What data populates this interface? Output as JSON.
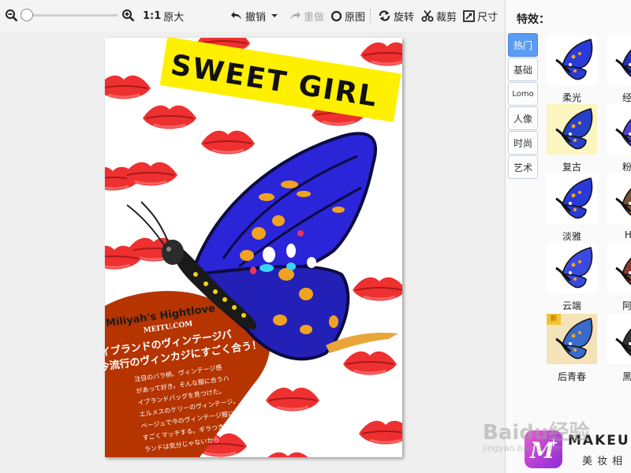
{
  "toolbar": {
    "zoom_out_icon": "zoom-out-icon",
    "zoom_in_icon": "zoom-in-icon",
    "zoom_value": 0,
    "actual_size_ratio": "1:1",
    "actual_size_label": "原大",
    "undo_label": "撤销",
    "redo_label": "重做",
    "original_label": "原图",
    "rotate_label": "旋转",
    "crop_label": "裁剪",
    "resize_label": "尺寸"
  },
  "poster": {
    "banner": "SWEET GIRL",
    "heart_title": "Miliyah's Hightlove",
    "heart_brand": "MEITU.COM",
    "heart_headline_1": "イブランドのヴィンテージバ",
    "heart_headline_2": "今流行のヴィンカジにすごく合う！",
    "heart_body": [
      "注目のバラ柄、ヴィンテージ感",
      "があって好き。そんな服に合うハ",
      "イブランドバッグを見つけた。",
      "エルメスのケリーのヴィンテージ。",
      "ページュで今のヴィンテージ服に",
      "すごくマッチする。ギラつきバイ",
      "ランドは気分じゃないから"
    ],
    "colors": {
      "banner_bg": "#ffef00",
      "heart": "#b53400",
      "lips": "#ee3030",
      "wing": "#2a25d8"
    }
  },
  "side": {
    "title": "特效：",
    "tabs": [
      "热门",
      "基础",
      "Lomo",
      "人像",
      "时尚",
      "艺术"
    ],
    "active_tab": "热门",
    "effects": [
      {
        "name": "柔光",
        "bg": "#ffffff"
      },
      {
        "name": "经典",
        "bg": "#ffffff"
      },
      {
        "name": "复古",
        "bg": "#fbf6c0"
      },
      {
        "name": "粉红",
        "bg": "#ffffff"
      },
      {
        "name": "淡雅",
        "bg": "#ffffff"
      },
      {
        "name": "HD",
        "bg": "#ffffff"
      },
      {
        "name": "云端",
        "bg": "#ffffff"
      },
      {
        "name": "阿宝",
        "bg": "#ffffff"
      },
      {
        "name": "后青春",
        "bg": "#f4e3b8"
      },
      {
        "name": "黑白",
        "bg": "#ffffff"
      }
    ],
    "new_badge": "新"
  },
  "branding": {
    "logo_text": "MAKEUPL",
    "logo_cn": "美妆相",
    "watermark": "Baidu经验",
    "watermark_sub": "jingyan.baidu.com"
  }
}
